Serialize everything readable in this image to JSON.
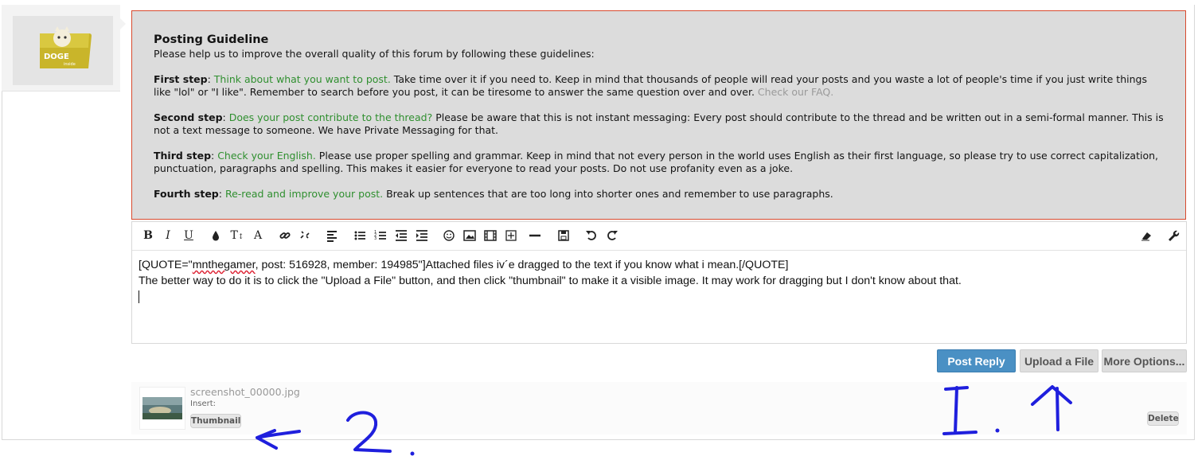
{
  "guideline": {
    "title": "Posting Guideline",
    "intro": "Please help us to improve the overall quality of this forum by following these guidelines:",
    "steps": [
      {
        "label": "First step",
        "highlight": "Think about what you want to post.",
        "text": " Take time over it if you need to. Keep in mind that thousands of people will read your posts and you waste a lot of people's time if you just write things like \"lol\" or \"I like\". Remember to search before you post, it can be tiresome to answer the same question over and over.",
        "link": "Check our FAQ."
      },
      {
        "label": "Second step",
        "highlight": "Does your post contribute to the thread?",
        "text": " Please be aware that this is not instant messaging: Every post should contribute to the thread and be written out in a semi-formal manner. This is not a text message to someone. We have Private Messaging for that."
      },
      {
        "label": "Third step",
        "highlight": "Check your English.",
        "text": " Please use proper spelling and grammar. Keep in mind that not every person in the world uses English as their first language, so please try to use correct capitalization, punctuation, paragraphs and spelling. This makes it easier for everyone to read your posts. Do not use profanity even as a joke."
      },
      {
        "label": "Fourth step",
        "highlight": "Re-read and improve your post.",
        "text": " Break up sentences that are too long into shorter ones and remember to use paragraphs."
      }
    ]
  },
  "avatar": {
    "logo_text": "DOGE",
    "logo_sub": "inside"
  },
  "editor": {
    "line1_before": "[QUOTE=\"",
    "line1_user": "mnthegamer",
    "line1_after": ", post: 516928, member: 194985\"]Attached files iv´e dragged to the text if you know what i mean.[/QUOTE]",
    "line2": "The better way to do it is to click the \"Upload a File\" button, and then click \"thumbnail\" to make it a visible image. It may work for dragging but I don't know about that."
  },
  "toolbar": {
    "bold": "B",
    "italic": "I",
    "underline": "U",
    "font_size": "T",
    "font_family": "A"
  },
  "buttons": {
    "post_reply": "Post Reply",
    "upload_file": "Upload a File",
    "more_options": "More Options..."
  },
  "attachment": {
    "filename": "screenshot_00000.jpg",
    "insert_label": "Insert:",
    "thumbnail_button": "Thumbnail",
    "delete_button": "Delete"
  },
  "annotations": {
    "one": "1.",
    "two": "2.",
    "ink_color": "#1f1fdd"
  }
}
